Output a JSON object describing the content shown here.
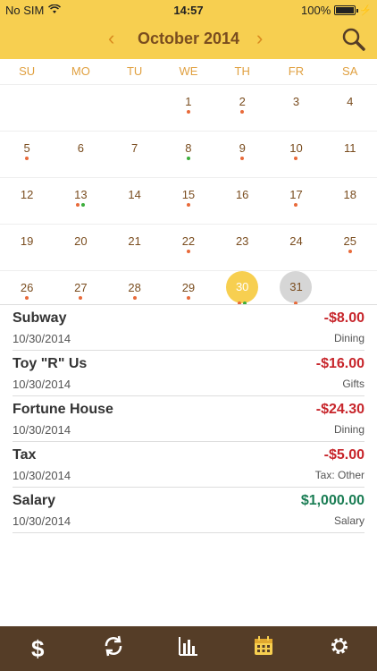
{
  "status": {
    "carrier": "No SIM",
    "time": "14:57",
    "battery": "100%"
  },
  "header": {
    "title": "October 2014"
  },
  "weekdays": [
    "SU",
    "MO",
    "TU",
    "WE",
    "TH",
    "FR",
    "SA"
  ],
  "colors": {
    "accent": "#f7cf50",
    "expense_dot": "#e86a3a",
    "income_dot": "#3cae3c",
    "negative": "#c7252b",
    "positive": "#1a7d54",
    "tabbar": "#553d27"
  },
  "calendar": [
    [
      null,
      null,
      null,
      {
        "d": "1",
        "dots": [
          "expense"
        ]
      },
      {
        "d": "2",
        "dots": [
          "expense"
        ]
      },
      {
        "d": "3",
        "dots": []
      },
      {
        "d": "4",
        "dots": []
      }
    ],
    [
      {
        "d": "5",
        "dots": [
          "expense"
        ]
      },
      {
        "d": "6",
        "dots": []
      },
      {
        "d": "7",
        "dots": []
      },
      {
        "d": "8",
        "dots": [
          "income"
        ]
      },
      {
        "d": "9",
        "dots": [
          "expense"
        ]
      },
      {
        "d": "10",
        "dots": [
          "expense"
        ]
      },
      {
        "d": "11",
        "dots": []
      }
    ],
    [
      {
        "d": "12",
        "dots": []
      },
      {
        "d": "13",
        "dots": [
          "expense",
          "income"
        ]
      },
      {
        "d": "14",
        "dots": []
      },
      {
        "d": "15",
        "dots": [
          "expense"
        ]
      },
      {
        "d": "16",
        "dots": []
      },
      {
        "d": "17",
        "dots": [
          "expense"
        ]
      },
      {
        "d": "18",
        "dots": []
      }
    ],
    [
      {
        "d": "19",
        "dots": []
      },
      {
        "d": "20",
        "dots": []
      },
      {
        "d": "21",
        "dots": []
      },
      {
        "d": "22",
        "dots": [
          "expense"
        ]
      },
      {
        "d": "23",
        "dots": []
      },
      {
        "d": "24",
        "dots": []
      },
      {
        "d": "25",
        "dots": [
          "expense"
        ]
      }
    ],
    [
      {
        "d": "26",
        "dots": [
          "expense"
        ]
      },
      {
        "d": "27",
        "dots": [
          "expense"
        ]
      },
      {
        "d": "28",
        "dots": [
          "expense"
        ]
      },
      {
        "d": "29",
        "dots": [
          "expense"
        ]
      },
      {
        "d": "30",
        "dots": [
          "expense",
          "income"
        ],
        "state": "today"
      },
      {
        "d": "31",
        "dots": [
          "expense"
        ],
        "state": "selected"
      },
      null
    ]
  ],
  "transactions": [
    {
      "name": "Subway",
      "date": "10/30/2014",
      "amount": "-$8.00",
      "category": "Dining",
      "type": "neg"
    },
    {
      "name": "Toy \"R\" Us",
      "date": "10/30/2014",
      "amount": "-$16.00",
      "category": "Gifts",
      "type": "neg"
    },
    {
      "name": "Fortune House",
      "date": "10/30/2014",
      "amount": "-$24.30",
      "category": "Dining",
      "type": "neg"
    },
    {
      "name": "Tax",
      "date": "10/30/2014",
      "amount": "-$5.00",
      "category": "Tax: Other",
      "type": "neg"
    },
    {
      "name": "Salary",
      "date": "10/30/2014",
      "amount": "$1,000.00",
      "category": "Salary",
      "type": "pos"
    }
  ],
  "tabs": [
    {
      "icon": "dollar-icon",
      "glyph": "$",
      "active": false
    },
    {
      "icon": "sync-icon",
      "glyph": "⟳",
      "active": false
    },
    {
      "icon": "bar-chart-icon",
      "glyph": "chart",
      "active": false
    },
    {
      "icon": "calendar-icon",
      "glyph": "cal",
      "active": true
    },
    {
      "icon": "gear-icon",
      "glyph": "⚙",
      "active": false
    }
  ]
}
